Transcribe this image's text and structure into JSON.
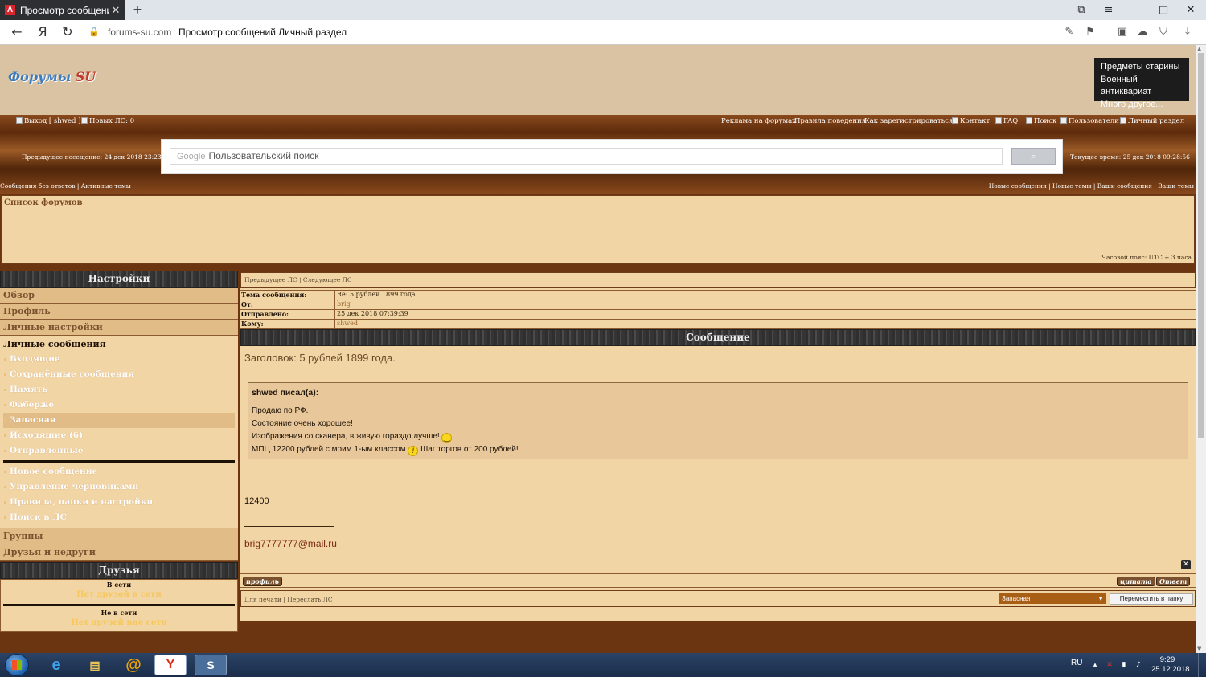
{
  "browser": {
    "tab_title": "Просмотр сообщений /",
    "tab_favicon": "A",
    "new_tab": "+",
    "url_domain": "forums-su.com",
    "url_title": "Просмотр сообщений Личный раздел"
  },
  "header": {
    "logo_main": "Форумы",
    "logo_accent": "SU",
    "ad_lines": [
      "Предметы старины",
      "Военный антиквариат",
      "Много другое..."
    ]
  },
  "toplinks": {
    "logout": "Выход [ shwed ]",
    "new_pm": "Новых ЛС: 0",
    "ads": "Реклама на форумах",
    "rules": "Правила поведения",
    "register": "Как зарегистрироваться?",
    "contact": "Контакт",
    "faq": "FAQ",
    "search": "Поиск",
    "users": "Пользователи",
    "personal": "Личный раздел"
  },
  "visit": {
    "prev": "Предыдущее посещение: 24 дек 2018 23:23:37",
    "current": "Текущее время: 25 дек 2018 09:28:56"
  },
  "search": {
    "brand": "Google",
    "placeholder": "Пользовательский поиск"
  },
  "sublinks": {
    "left": "Сообщения без ответов | Активные темы",
    "right": "Новые сообщения | Новые темы | Ваши сообщения | Ваши темы"
  },
  "forumlist": {
    "title": "Список форумов",
    "timezone": "Часовой пояс: UTC + 3 часа"
  },
  "sidebar": {
    "settings_title": "Настройки",
    "overview": "Обзор",
    "profile": "Профиль",
    "personal_settings": "Личные настройки",
    "pm_title": "Личные сообщения",
    "pm_links": [
      "Входящие",
      "Сохранённые сообщения",
      "Память",
      "Фаберже",
      "Запасная",
      "Исходящие (6)",
      "Отправленные"
    ],
    "pm_actions": [
      "Новое сообщение",
      "Управление черновиками",
      "Правила, папки и настройки",
      "Поиск в ЛС"
    ],
    "groups": "Группы",
    "friends_foes": "Друзья и недруги",
    "friends_title": "Друзья",
    "online": "В сети",
    "online_empty": "Нет друзей в сети",
    "offline": "Не в сети",
    "offline_empty": "Нет друзей вне сети"
  },
  "message": {
    "pager": "Предыдущее ЛС | Следующее ЛС",
    "fields": [
      {
        "k": "Тема сообщения:",
        "v": "Re: 5 рублей 1899 года."
      },
      {
        "k": "От:",
        "v": "brig"
      },
      {
        "k": "Отправлено:",
        "v": "25 дек 2018 07:39:39"
      },
      {
        "k": "Кому:",
        "v": "shwed"
      }
    ],
    "header": "Сообщение",
    "subject": "Заголовок: 5 рублей 1899 года.",
    "quote_author": "shwed писал(а):",
    "quote_lines": [
      "Продаю по РФ.",
      "Состояние очень хорошее!",
      "Изображения со сканера, в живую гораздо лучше!",
      "МПЦ 12200 рублей с моим 1-ым классом",
      "Шаг торгов от 200 рублей!"
    ],
    "price": "12400",
    "signature": "brig7777777@mail.ru",
    "close": "✕",
    "profile_btn": "профиль",
    "quote_btn": "цитата",
    "reply_btn": "Ответ",
    "bottom_left": "Для печати | Переслать ЛС",
    "folder": "Запасная",
    "move_btn": "Переместить в папку"
  },
  "taskbar": {
    "lang": "RU",
    "time": "9:29",
    "date": "25.12.2018"
  }
}
